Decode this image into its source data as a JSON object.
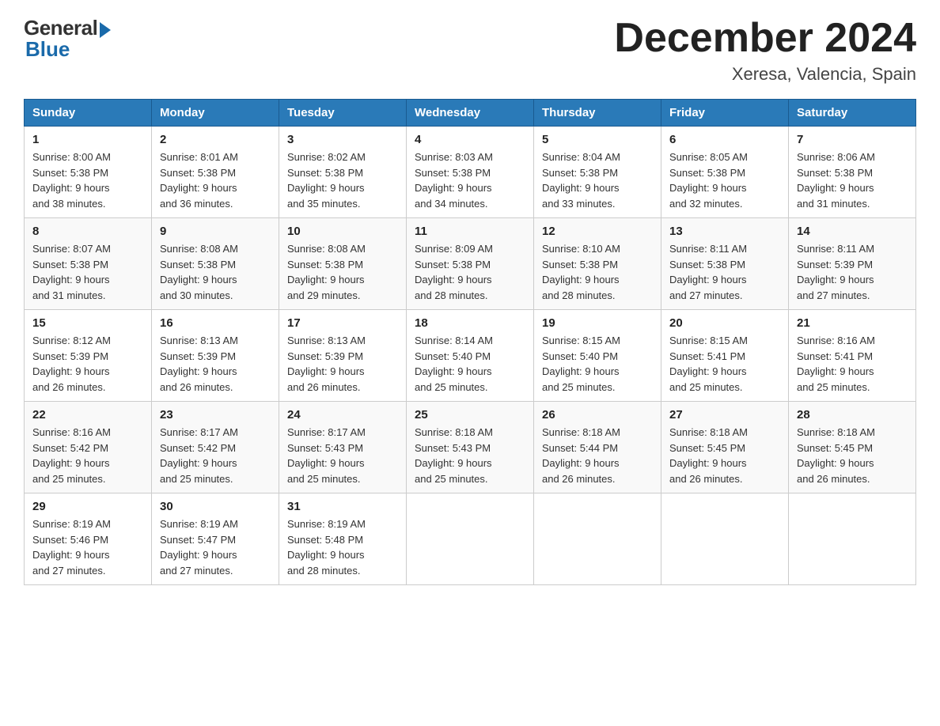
{
  "logo": {
    "general": "General",
    "blue": "Blue"
  },
  "title": "December 2024",
  "location": "Xeresa, Valencia, Spain",
  "days_of_week": [
    "Sunday",
    "Monday",
    "Tuesday",
    "Wednesday",
    "Thursday",
    "Friday",
    "Saturday"
  ],
  "weeks": [
    [
      {
        "day": "1",
        "sunrise": "8:00 AM",
        "sunset": "5:38 PM",
        "daylight": "9 hours and 38 minutes."
      },
      {
        "day": "2",
        "sunrise": "8:01 AM",
        "sunset": "5:38 PM",
        "daylight": "9 hours and 36 minutes."
      },
      {
        "day": "3",
        "sunrise": "8:02 AM",
        "sunset": "5:38 PM",
        "daylight": "9 hours and 35 minutes."
      },
      {
        "day": "4",
        "sunrise": "8:03 AM",
        "sunset": "5:38 PM",
        "daylight": "9 hours and 34 minutes."
      },
      {
        "day": "5",
        "sunrise": "8:04 AM",
        "sunset": "5:38 PM",
        "daylight": "9 hours and 33 minutes."
      },
      {
        "day": "6",
        "sunrise": "8:05 AM",
        "sunset": "5:38 PM",
        "daylight": "9 hours and 32 minutes."
      },
      {
        "day": "7",
        "sunrise": "8:06 AM",
        "sunset": "5:38 PM",
        "daylight": "9 hours and 31 minutes."
      }
    ],
    [
      {
        "day": "8",
        "sunrise": "8:07 AM",
        "sunset": "5:38 PM",
        "daylight": "9 hours and 31 minutes."
      },
      {
        "day": "9",
        "sunrise": "8:08 AM",
        "sunset": "5:38 PM",
        "daylight": "9 hours and 30 minutes."
      },
      {
        "day": "10",
        "sunrise": "8:08 AM",
        "sunset": "5:38 PM",
        "daylight": "9 hours and 29 minutes."
      },
      {
        "day": "11",
        "sunrise": "8:09 AM",
        "sunset": "5:38 PM",
        "daylight": "9 hours and 28 minutes."
      },
      {
        "day": "12",
        "sunrise": "8:10 AM",
        "sunset": "5:38 PM",
        "daylight": "9 hours and 28 minutes."
      },
      {
        "day": "13",
        "sunrise": "8:11 AM",
        "sunset": "5:38 PM",
        "daylight": "9 hours and 27 minutes."
      },
      {
        "day": "14",
        "sunrise": "8:11 AM",
        "sunset": "5:39 PM",
        "daylight": "9 hours and 27 minutes."
      }
    ],
    [
      {
        "day": "15",
        "sunrise": "8:12 AM",
        "sunset": "5:39 PM",
        "daylight": "9 hours and 26 minutes."
      },
      {
        "day": "16",
        "sunrise": "8:13 AM",
        "sunset": "5:39 PM",
        "daylight": "9 hours and 26 minutes."
      },
      {
        "day": "17",
        "sunrise": "8:13 AM",
        "sunset": "5:39 PM",
        "daylight": "9 hours and 26 minutes."
      },
      {
        "day": "18",
        "sunrise": "8:14 AM",
        "sunset": "5:40 PM",
        "daylight": "9 hours and 25 minutes."
      },
      {
        "day": "19",
        "sunrise": "8:15 AM",
        "sunset": "5:40 PM",
        "daylight": "9 hours and 25 minutes."
      },
      {
        "day": "20",
        "sunrise": "8:15 AM",
        "sunset": "5:41 PM",
        "daylight": "9 hours and 25 minutes."
      },
      {
        "day": "21",
        "sunrise": "8:16 AM",
        "sunset": "5:41 PM",
        "daylight": "9 hours and 25 minutes."
      }
    ],
    [
      {
        "day": "22",
        "sunrise": "8:16 AM",
        "sunset": "5:42 PM",
        "daylight": "9 hours and 25 minutes."
      },
      {
        "day": "23",
        "sunrise": "8:17 AM",
        "sunset": "5:42 PM",
        "daylight": "9 hours and 25 minutes."
      },
      {
        "day": "24",
        "sunrise": "8:17 AM",
        "sunset": "5:43 PM",
        "daylight": "9 hours and 25 minutes."
      },
      {
        "day": "25",
        "sunrise": "8:18 AM",
        "sunset": "5:43 PM",
        "daylight": "9 hours and 25 minutes."
      },
      {
        "day": "26",
        "sunrise": "8:18 AM",
        "sunset": "5:44 PM",
        "daylight": "9 hours and 26 minutes."
      },
      {
        "day": "27",
        "sunrise": "8:18 AM",
        "sunset": "5:45 PM",
        "daylight": "9 hours and 26 minutes."
      },
      {
        "day": "28",
        "sunrise": "8:18 AM",
        "sunset": "5:45 PM",
        "daylight": "9 hours and 26 minutes."
      }
    ],
    [
      {
        "day": "29",
        "sunrise": "8:19 AM",
        "sunset": "5:46 PM",
        "daylight": "9 hours and 27 minutes."
      },
      {
        "day": "30",
        "sunrise": "8:19 AM",
        "sunset": "5:47 PM",
        "daylight": "9 hours and 27 minutes."
      },
      {
        "day": "31",
        "sunrise": "8:19 AM",
        "sunset": "5:48 PM",
        "daylight": "9 hours and 28 minutes."
      },
      null,
      null,
      null,
      null
    ]
  ],
  "labels": {
    "sunrise": "Sunrise:",
    "sunset": "Sunset:",
    "daylight": "Daylight:"
  }
}
